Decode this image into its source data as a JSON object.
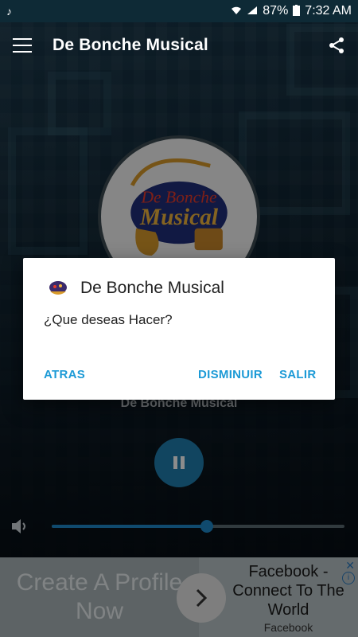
{
  "status_bar": {
    "music_icon": "music-note-icon",
    "battery": "87%",
    "time": "7:32 AM"
  },
  "app_bar": {
    "title": "De Bonche Musical",
    "menu_icon": "hamburger-menu-icon",
    "share_icon": "share-icon"
  },
  "logo": {
    "line1": "De Bonche",
    "line2": "Musical"
  },
  "player": {
    "station_name": "De Bonche Musical",
    "volume_level": 0.53
  },
  "dialog": {
    "title": "De Bonche Musical",
    "message": "¿Que deseas Hacer?",
    "buttons": {
      "back": "ATRAS",
      "minimize": "DISMINUIR",
      "exit": "SALIR"
    }
  },
  "ad": {
    "left_text": "Create A Profile Now",
    "headline": "Facebook - Connect To The World",
    "source": "Facebook"
  },
  "colors": {
    "accent": "#1c9ad6",
    "player_button": "#1f7fb0"
  }
}
